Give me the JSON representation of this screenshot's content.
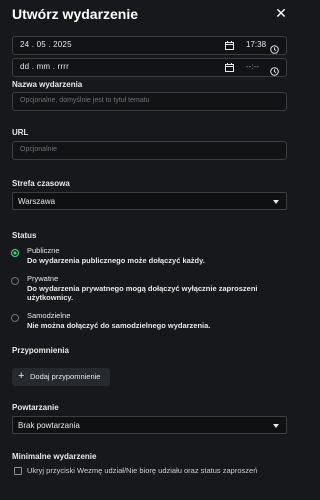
{
  "dialog": {
    "title": "Utwórz wydarzenie",
    "close_icon": "close-icon"
  },
  "start": {
    "date": "24 . 05 . 2025",
    "time": "17:38"
  },
  "end": {
    "date_placeholder": "dd . mm . rrrr",
    "time_placeholder": "--:--"
  },
  "name": {
    "label": "Nazwa wydarzenia",
    "placeholder": "Opcjonalne, domyślnie jest to tytuł tematu"
  },
  "url": {
    "label": "URL",
    "placeholder": "Opcjonalnie"
  },
  "timezone": {
    "label": "Strefa czasowa",
    "value": "Warszawa"
  },
  "status": {
    "label": "Status",
    "options": [
      {
        "title": "Publiczne",
        "desc": "Do wydarzenia publicznego może dołączyć każdy.",
        "checked": true
      },
      {
        "title": "Prywatne",
        "desc": "Do wydarzenia prywatnego mogą dołączyć wyłącznie zaproszeni użytkownicy.",
        "checked": false
      },
      {
        "title": "Samodzielne",
        "desc": "Nie można dołączyć do samodzielnego wydarzenia.",
        "checked": false
      }
    ]
  },
  "reminders": {
    "label": "Przypomnienia",
    "add_label": "Dodaj przypomnienie"
  },
  "recurrence": {
    "label": "Powtarzanie",
    "value": "Brak powtarzania"
  },
  "minimal": {
    "label": "Minimalne wydarzenie",
    "checkbox_label": "Ukryj przyciski Wezmę udział/Nie biorę udziału oraz status zaproszeń"
  },
  "colors": {
    "background": "#16181b",
    "accent": "#3ddc84",
    "border": "#3a3d42"
  }
}
